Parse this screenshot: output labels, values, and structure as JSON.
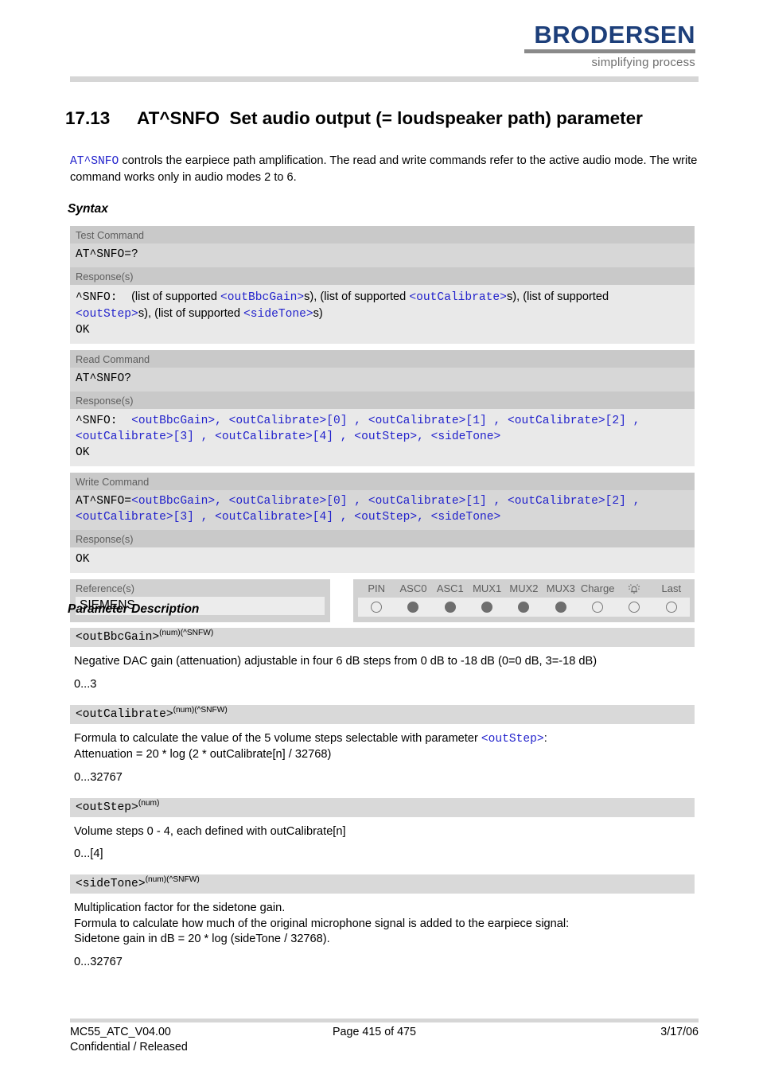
{
  "header": {
    "logo_word": "BRODERSEN",
    "logo_tagline": "simplifying process"
  },
  "title": {
    "number": "17.13",
    "command": "AT^SNFO",
    "text": "Set audio output (= loudspeaker path) parameter"
  },
  "intro": {
    "code": "AT^SNFO",
    "line1": " controls the earpiece path amplification. The read and write commands refer to the active audio mode.",
    "line2": "The write command works only in audio modes 2 to 6."
  },
  "sections": {
    "syntax_heading": "Syntax",
    "param_heading": "Parameter Description"
  },
  "syntax": {
    "test": {
      "label": "Test Command",
      "command": "AT^SNFO=?",
      "response_label": "Response(s)",
      "resp_prefix": "^SNFO:",
      "resp_t1": "(list of supported ",
      "resp_p1": "<outBbcGain>",
      "resp_t2": "s), (list of supported ",
      "resp_p2": "<outCalibrate>",
      "resp_t3": "s), (list of supported",
      "resp_p3": "<outStep>",
      "resp_t4": "s), (list of supported ",
      "resp_p4": "<sideTone>",
      "resp_t5": "s)",
      "ok": "OK"
    },
    "read": {
      "label": "Read Command",
      "command": "AT^SNFO?",
      "response_label": "Response(s)",
      "resp_prefix": "^SNFO:",
      "resp_line1": "<outBbcGain>, <outCalibrate>[0] , <outCalibrate>[1] , <outCalibrate>[2] ,",
      "resp_line2": "<outCalibrate>[3] , <outCalibrate>[4] , <outStep>, <sideTone>",
      "ok": "OK"
    },
    "write": {
      "label": "Write Command",
      "command_prefix": "AT^SNFO=",
      "command_line1": "<outBbcGain>, <outCalibrate>[0] , <outCalibrate>[1] , <outCalibrate>[2] ,",
      "command_line2": "<outCalibrate>[3] , <outCalibrate>[4] , <outStep>, <sideTone>",
      "response_label": "Response(s)",
      "ok": "OK"
    },
    "reference": {
      "label": "Reference(s)",
      "value": "SIEMENS"
    },
    "pin_table": {
      "columns": [
        "PIN",
        "ASC0",
        "ASC1",
        "MUX1",
        "MUX2",
        "MUX3",
        "Charge",
        "alarm-bell-icon",
        "Last"
      ],
      "states": [
        "empty",
        "filled",
        "filled",
        "filled",
        "filled",
        "filled",
        "empty",
        "empty",
        "empty"
      ]
    }
  },
  "parameters": [
    {
      "name": "<outBbcGain>",
      "sup": "(num)(^SNFW)",
      "body": "Negative DAC gain (attenuation) adjustable in four 6 dB steps from 0 dB to -18 dB (0=0 dB, 3=-18 dB)",
      "range": "0...3"
    },
    {
      "name": "<outCalibrate>",
      "sup": "(num)(^SNFW)",
      "body_pre": "Formula to calculate the value of the 5 volume steps selectable with parameter ",
      "body_code": "<outStep>",
      "body_post": ":",
      "body_line2": "Attenuation = 20 * log (2 * outCalibrate[n] / 32768)",
      "range": "0...32767"
    },
    {
      "name": "<outStep>",
      "sup": "(num)",
      "body": "Volume steps 0 - 4, each defined with outCalibrate[n]",
      "range": "0...[4]"
    },
    {
      "name": "<sideTone>",
      "sup": "(num)(^SNFW)",
      "body_line1": "Multiplication factor for the sidetone gain.",
      "body_line2": "Formula to calculate how much of the original microphone signal is added to the earpiece signal:",
      "body_line3": "Sidetone gain in dB = 20 * log (sideTone / 32768).",
      "range": "0...32767"
    }
  ],
  "footer": {
    "doc_id": "MC55_ATC_V04.00",
    "page": "Page 415 of 475",
    "date": "3/17/06",
    "classification": "Confidential / Released"
  },
  "colors": {
    "logo_blue": "#1d3f7a",
    "code_blue": "#2222cc",
    "label_gray": "#c9c9c9",
    "cmd_gray": "#d7d7d7",
    "resp_gray": "#e9e9e9"
  }
}
